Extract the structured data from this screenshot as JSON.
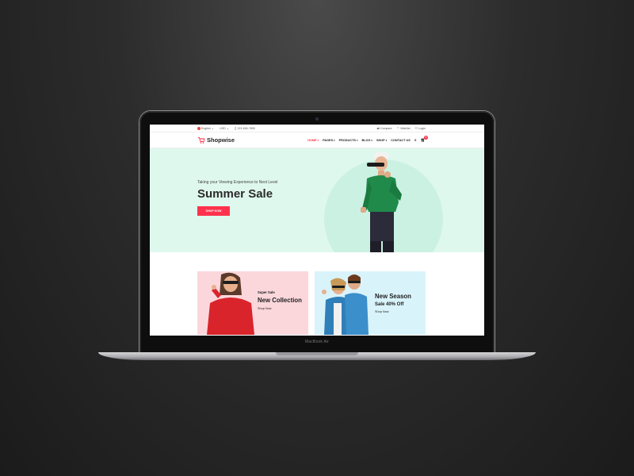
{
  "device": {
    "brand": "MacBook Air"
  },
  "topbar": {
    "language": "English",
    "currency": "USD",
    "phone": "123-456-7890",
    "compare": "Compare",
    "wishlist": "Wishlist",
    "login": "Login"
  },
  "navbar": {
    "logo": "Shopwise",
    "menu": [
      "HOME",
      "PAGES",
      "PRODUCTS",
      "BLOG",
      "SHOP",
      "CONTACT US"
    ],
    "cart_count": "0"
  },
  "hero": {
    "tagline": "Taking your Viewing Experience to Next Level",
    "title": "Summer Sale",
    "button": "SHOP NOW"
  },
  "banners": [
    {
      "small": "Super Sale",
      "big": "New Collection",
      "link": "Shop Now"
    },
    {
      "big": "New Season",
      "mid": "Sale 40% Off",
      "link": "Shop Now"
    }
  ],
  "colors": {
    "accent": "#ff324d",
    "hero_bg": "#dff8ee",
    "banner_pink": "#fbd7dc",
    "banner_blue": "#d9f3fb"
  }
}
